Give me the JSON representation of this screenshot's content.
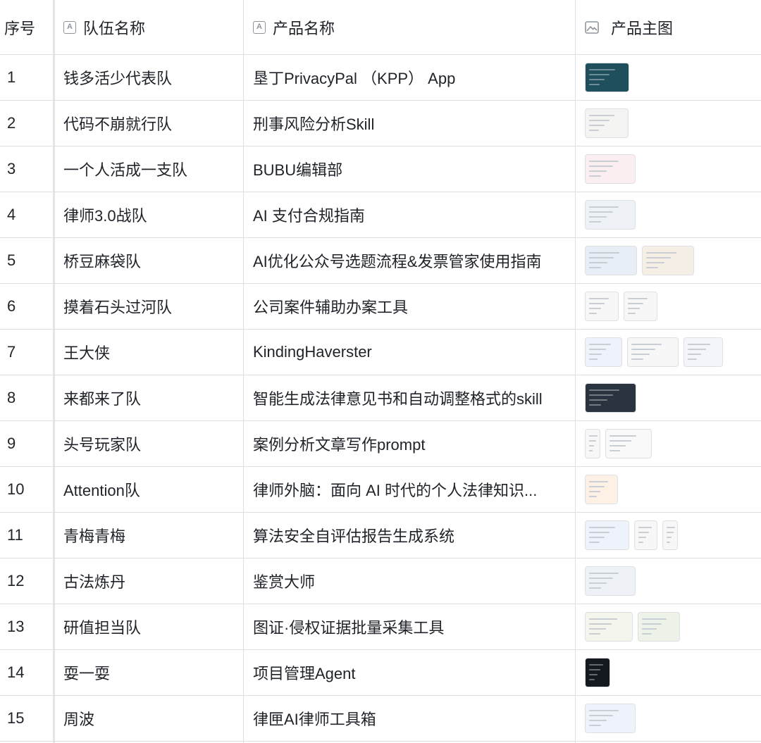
{
  "header": {
    "index": "序号",
    "team": "队伍名称",
    "product": "产品名称",
    "image": "产品主图"
  },
  "header_icons": {
    "team": "text-field-icon",
    "product": "text-field-icon",
    "image": "image-field-icon"
  },
  "rows": [
    {
      "index": "1",
      "team": "钱多活少代表队",
      "product": "垦丁PrivacyPal （KPP） App",
      "thumbs": [
        "#1f4f5c"
      ]
    },
    {
      "index": "2",
      "team": "代码不崩就行队",
      "product": "刑事风险分析Skill",
      "thumbs": [
        "#f4f4f2"
      ]
    },
    {
      "index": "3",
      "team": "一个人活成一支队",
      "product": "BUBU编辑部",
      "thumbs": [
        "#fbeef0"
      ]
    },
    {
      "index": "4",
      "team": "律师3.0战队",
      "product": "AI 支付合规指南",
      "thumbs": [
        "#eef2f7"
      ]
    },
    {
      "index": "5",
      "team": "桥豆麻袋队",
      "product": "AI优化公众号选题流程&发票管家使用指南",
      "thumbs": [
        "#e7eef6",
        "#f6efe6"
      ]
    },
    {
      "index": "6",
      "team": "摸着石头过河队",
      "product": "公司案件辅助办案工具",
      "thumbs": [
        "#f7f7f7",
        "#f7f7f7"
      ]
    },
    {
      "index": "7",
      "team": "王大侠",
      "product": "KindingHaverster",
      "thumbs": [
        "#eef3fb",
        "#f7f7f7",
        "#f3f5fb"
      ]
    },
    {
      "index": "8",
      "team": "来都来了队",
      "product": "智能生成法律意见书和自动调整格式的skill",
      "thumbs": [
        "#2a3340"
      ]
    },
    {
      "index": "9",
      "team": "头号玩家队",
      "product": "案例分析文章写作prompt",
      "thumbs": [
        "#f7f7f7",
        "#f9f9f9"
      ]
    },
    {
      "index": "10",
      "team": "Attention队",
      "product": "律师外脑：面向 AI 时代的个人法律知识...",
      "thumbs": [
        "#fdf1e6"
      ]
    },
    {
      "index": "11",
      "team": "青梅青梅",
      "product": "算法安全自评估报告生成系统",
      "thumbs": [
        "#eef3fb",
        "#f7f7f7",
        "#f7f7f7"
      ]
    },
    {
      "index": "12",
      "team": "古法炼丹",
      "product": "鉴赏大师",
      "thumbs": [
        "#eef1f6"
      ]
    },
    {
      "index": "13",
      "team": "研值担当队",
      "product": "图证·侵权证据批量采集工具",
      "thumbs": [
        "#f4f6ee",
        "#eef3ea"
      ]
    },
    {
      "index": "14",
      "team": "耍一耍",
      "product": "项目管理Agent",
      "thumbs": [
        "#14181f"
      ]
    },
    {
      "index": "15",
      "team": "周波",
      "product": "律匣AI律师工具箱",
      "thumbs": [
        "#eef2fa"
      ]
    }
  ]
}
